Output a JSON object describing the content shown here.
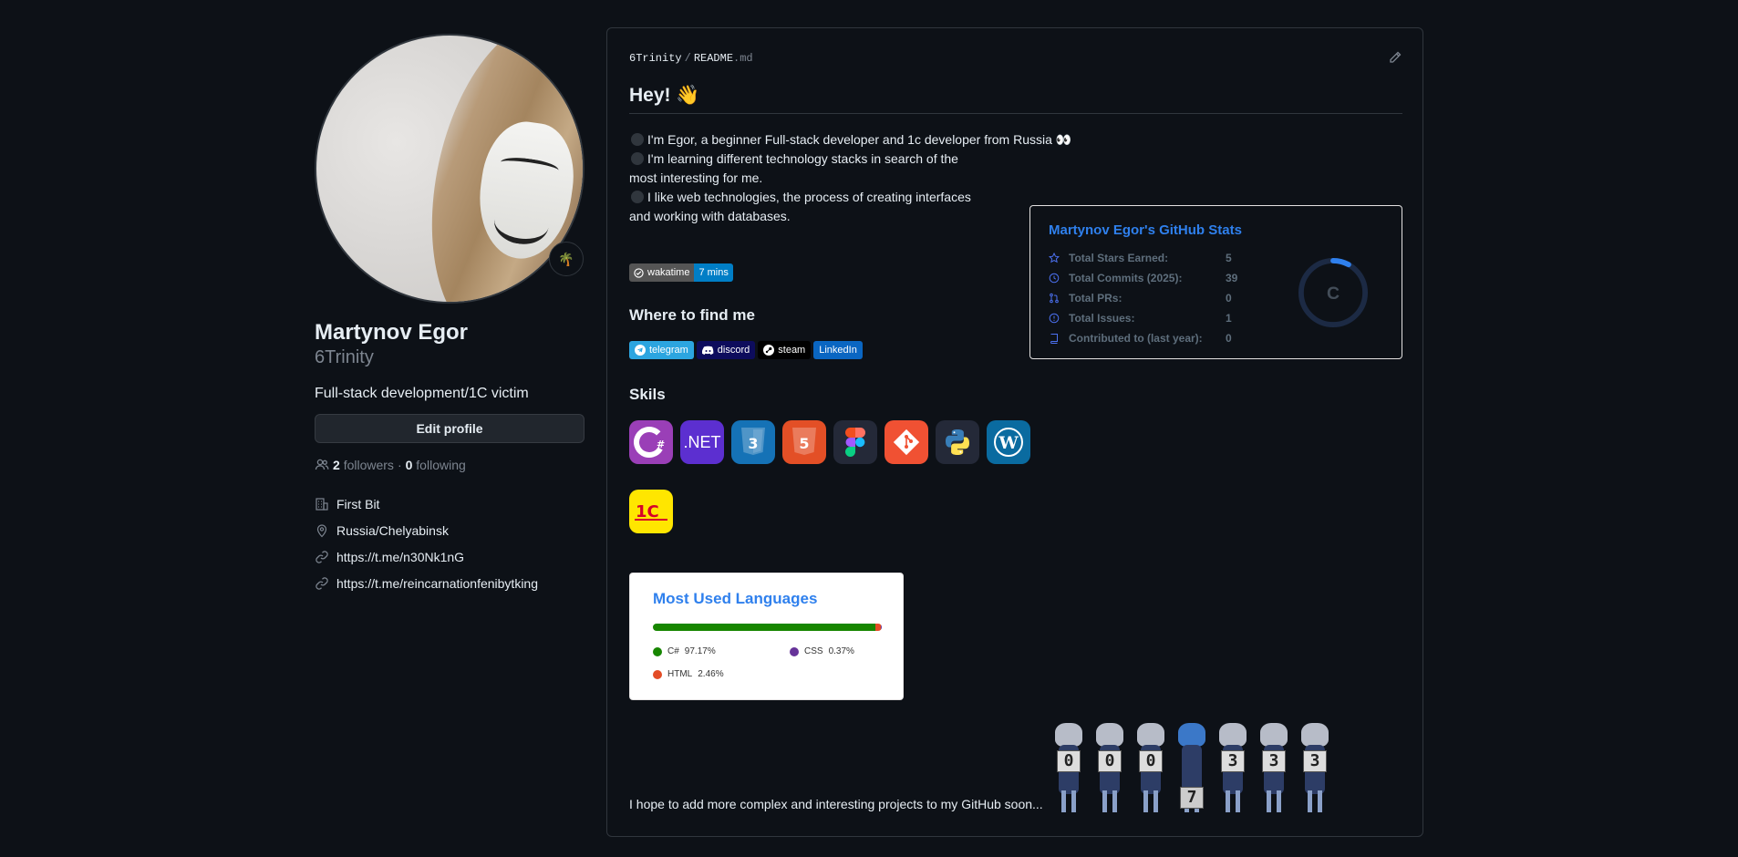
{
  "profile": {
    "name": "Martynov Egor",
    "login": "6Trinity",
    "status_emoji": "🌴",
    "bio": "Full-stack development/1C victim",
    "edit_button": "Edit profile",
    "followers_count": "2",
    "followers_label": "followers",
    "separator": "·",
    "following_count": "0",
    "following_label": "following",
    "company": "First Bit",
    "location": "Russia/Chelyabinsk",
    "links": [
      "https://t.me/n30Nk1nG",
      "https://t.me/reincarnationfenibytking"
    ]
  },
  "readme": {
    "owner": "6Trinity",
    "separator": "/",
    "file_name": "README",
    "file_ext": ".md",
    "heading": "Hey! 👋",
    "intro": [
      "I'm Egor, a beginner Full-stack developer and 1c developer from Russia 👀",
      "I'm learning different technology stacks in search of the",
      "most interesting for me.",
      "I like web technologies, the process of creating interfaces",
      "and working with databases."
    ],
    "wakatime": {
      "label": "wakatime",
      "value": "7 mins"
    },
    "find_me_heading": "Where to find me",
    "socials": [
      "telegram",
      "discord",
      "steam",
      "LinkedIn"
    ],
    "skills_heading": "Skils",
    "skills": [
      {
        "icon": "csharp-icon",
        "text": "C#"
      },
      {
        "icon": "dotnet-icon",
        "text": ".NET"
      },
      {
        "icon": "css3-icon",
        "text": "3"
      },
      {
        "icon": "html5-icon",
        "text": "5"
      },
      {
        "icon": "figma-icon",
        "text": ""
      },
      {
        "icon": "git-icon",
        "text": ""
      },
      {
        "icon": "python-icon",
        "text": ""
      },
      {
        "icon": "wordpress-icon",
        "text": "W"
      },
      {
        "icon": "1c-icon",
        "text": "1C"
      }
    ],
    "github_stats": {
      "title": "Martynov Egor's GitHub Stats",
      "rows": [
        {
          "label": "Total Stars Earned:",
          "value": "5"
        },
        {
          "label": "Total Commits (2025):",
          "value": "39"
        },
        {
          "label": "Total PRs:",
          "value": "0"
        },
        {
          "label": "Total Issues:",
          "value": "1"
        },
        {
          "label": "Contributed to (last year):",
          "value": "0"
        }
      ],
      "rank": "C",
      "rank_progress": 0.08,
      "colors": {
        "title": "#2f80ed",
        "ring": "#2f80ed"
      }
    },
    "languages": {
      "title": "Most Used Languages",
      "items": [
        {
          "name": "C#",
          "percent": "97.17%",
          "value": 97.17,
          "color": "#178600"
        },
        {
          "name": "CSS",
          "percent": "0.37%",
          "value": 0.37,
          "color": "#663399"
        },
        {
          "name": "HTML",
          "percent": "2.46%",
          "value": 2.46,
          "color": "#e34c26"
        }
      ]
    },
    "visitor_counter": [
      "0",
      "0",
      "0",
      "7",
      "3",
      "3",
      "3"
    ],
    "outro": "I hope to add more complex and interesting projects to my GitHub soon..."
  }
}
